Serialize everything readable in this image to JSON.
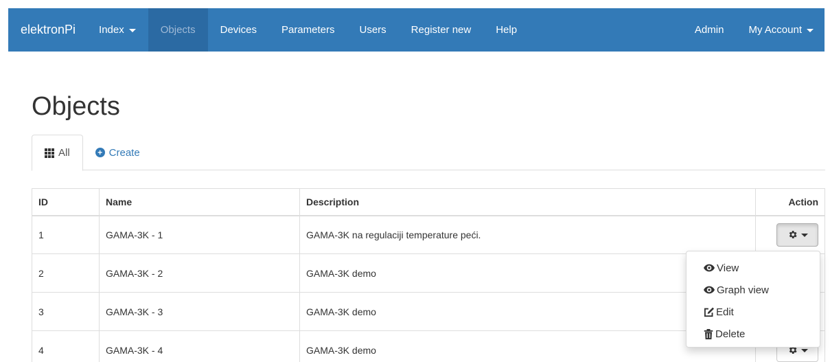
{
  "navbar": {
    "brand": "elektronPi",
    "items": [
      {
        "label": "Index",
        "dropdown": true,
        "active": false
      },
      {
        "label": "Objects",
        "dropdown": false,
        "active": true
      },
      {
        "label": "Devices",
        "dropdown": false,
        "active": false
      },
      {
        "label": "Parameters",
        "dropdown": false,
        "active": false
      },
      {
        "label": "Users",
        "dropdown": false,
        "active": false
      },
      {
        "label": "Register new",
        "dropdown": false,
        "active": false
      },
      {
        "label": "Help",
        "dropdown": false,
        "active": false
      }
    ],
    "right": {
      "admin": "Admin",
      "account": "My Account"
    }
  },
  "page": {
    "title": "Objects"
  },
  "tabs": [
    {
      "label": "All",
      "icon": "grid-icon",
      "active": true
    },
    {
      "label": "Create",
      "icon": "plus-circle-icon",
      "active": false
    }
  ],
  "table": {
    "headers": {
      "id": "ID",
      "name": "Name",
      "description": "Description",
      "action": "Action"
    },
    "rows": [
      {
        "id": "1",
        "name": "GAMA-3K - 1",
        "description": "GAMA-3K na regulaciji temperature peći."
      },
      {
        "id": "2",
        "name": "GAMA-3K - 2",
        "description": "GAMA-3K demo"
      },
      {
        "id": "3",
        "name": "GAMA-3K - 3",
        "description": "GAMA-3K demo"
      },
      {
        "id": "4",
        "name": "GAMA-3K - 4",
        "description": "GAMA-3K demo"
      }
    ]
  },
  "dropdown_menu": {
    "items": [
      {
        "label": "View",
        "icon": "eye-icon"
      },
      {
        "label": "Graph view",
        "icon": "eye-icon"
      },
      {
        "label": "Edit",
        "icon": "edit-icon"
      },
      {
        "label": "Delete",
        "icon": "trash-icon"
      }
    ]
  },
  "colors": {
    "navbar": "#337ab7",
    "navbar_active": "#2b6aa3",
    "link": "#337ab7",
    "border": "#dddddd"
  }
}
